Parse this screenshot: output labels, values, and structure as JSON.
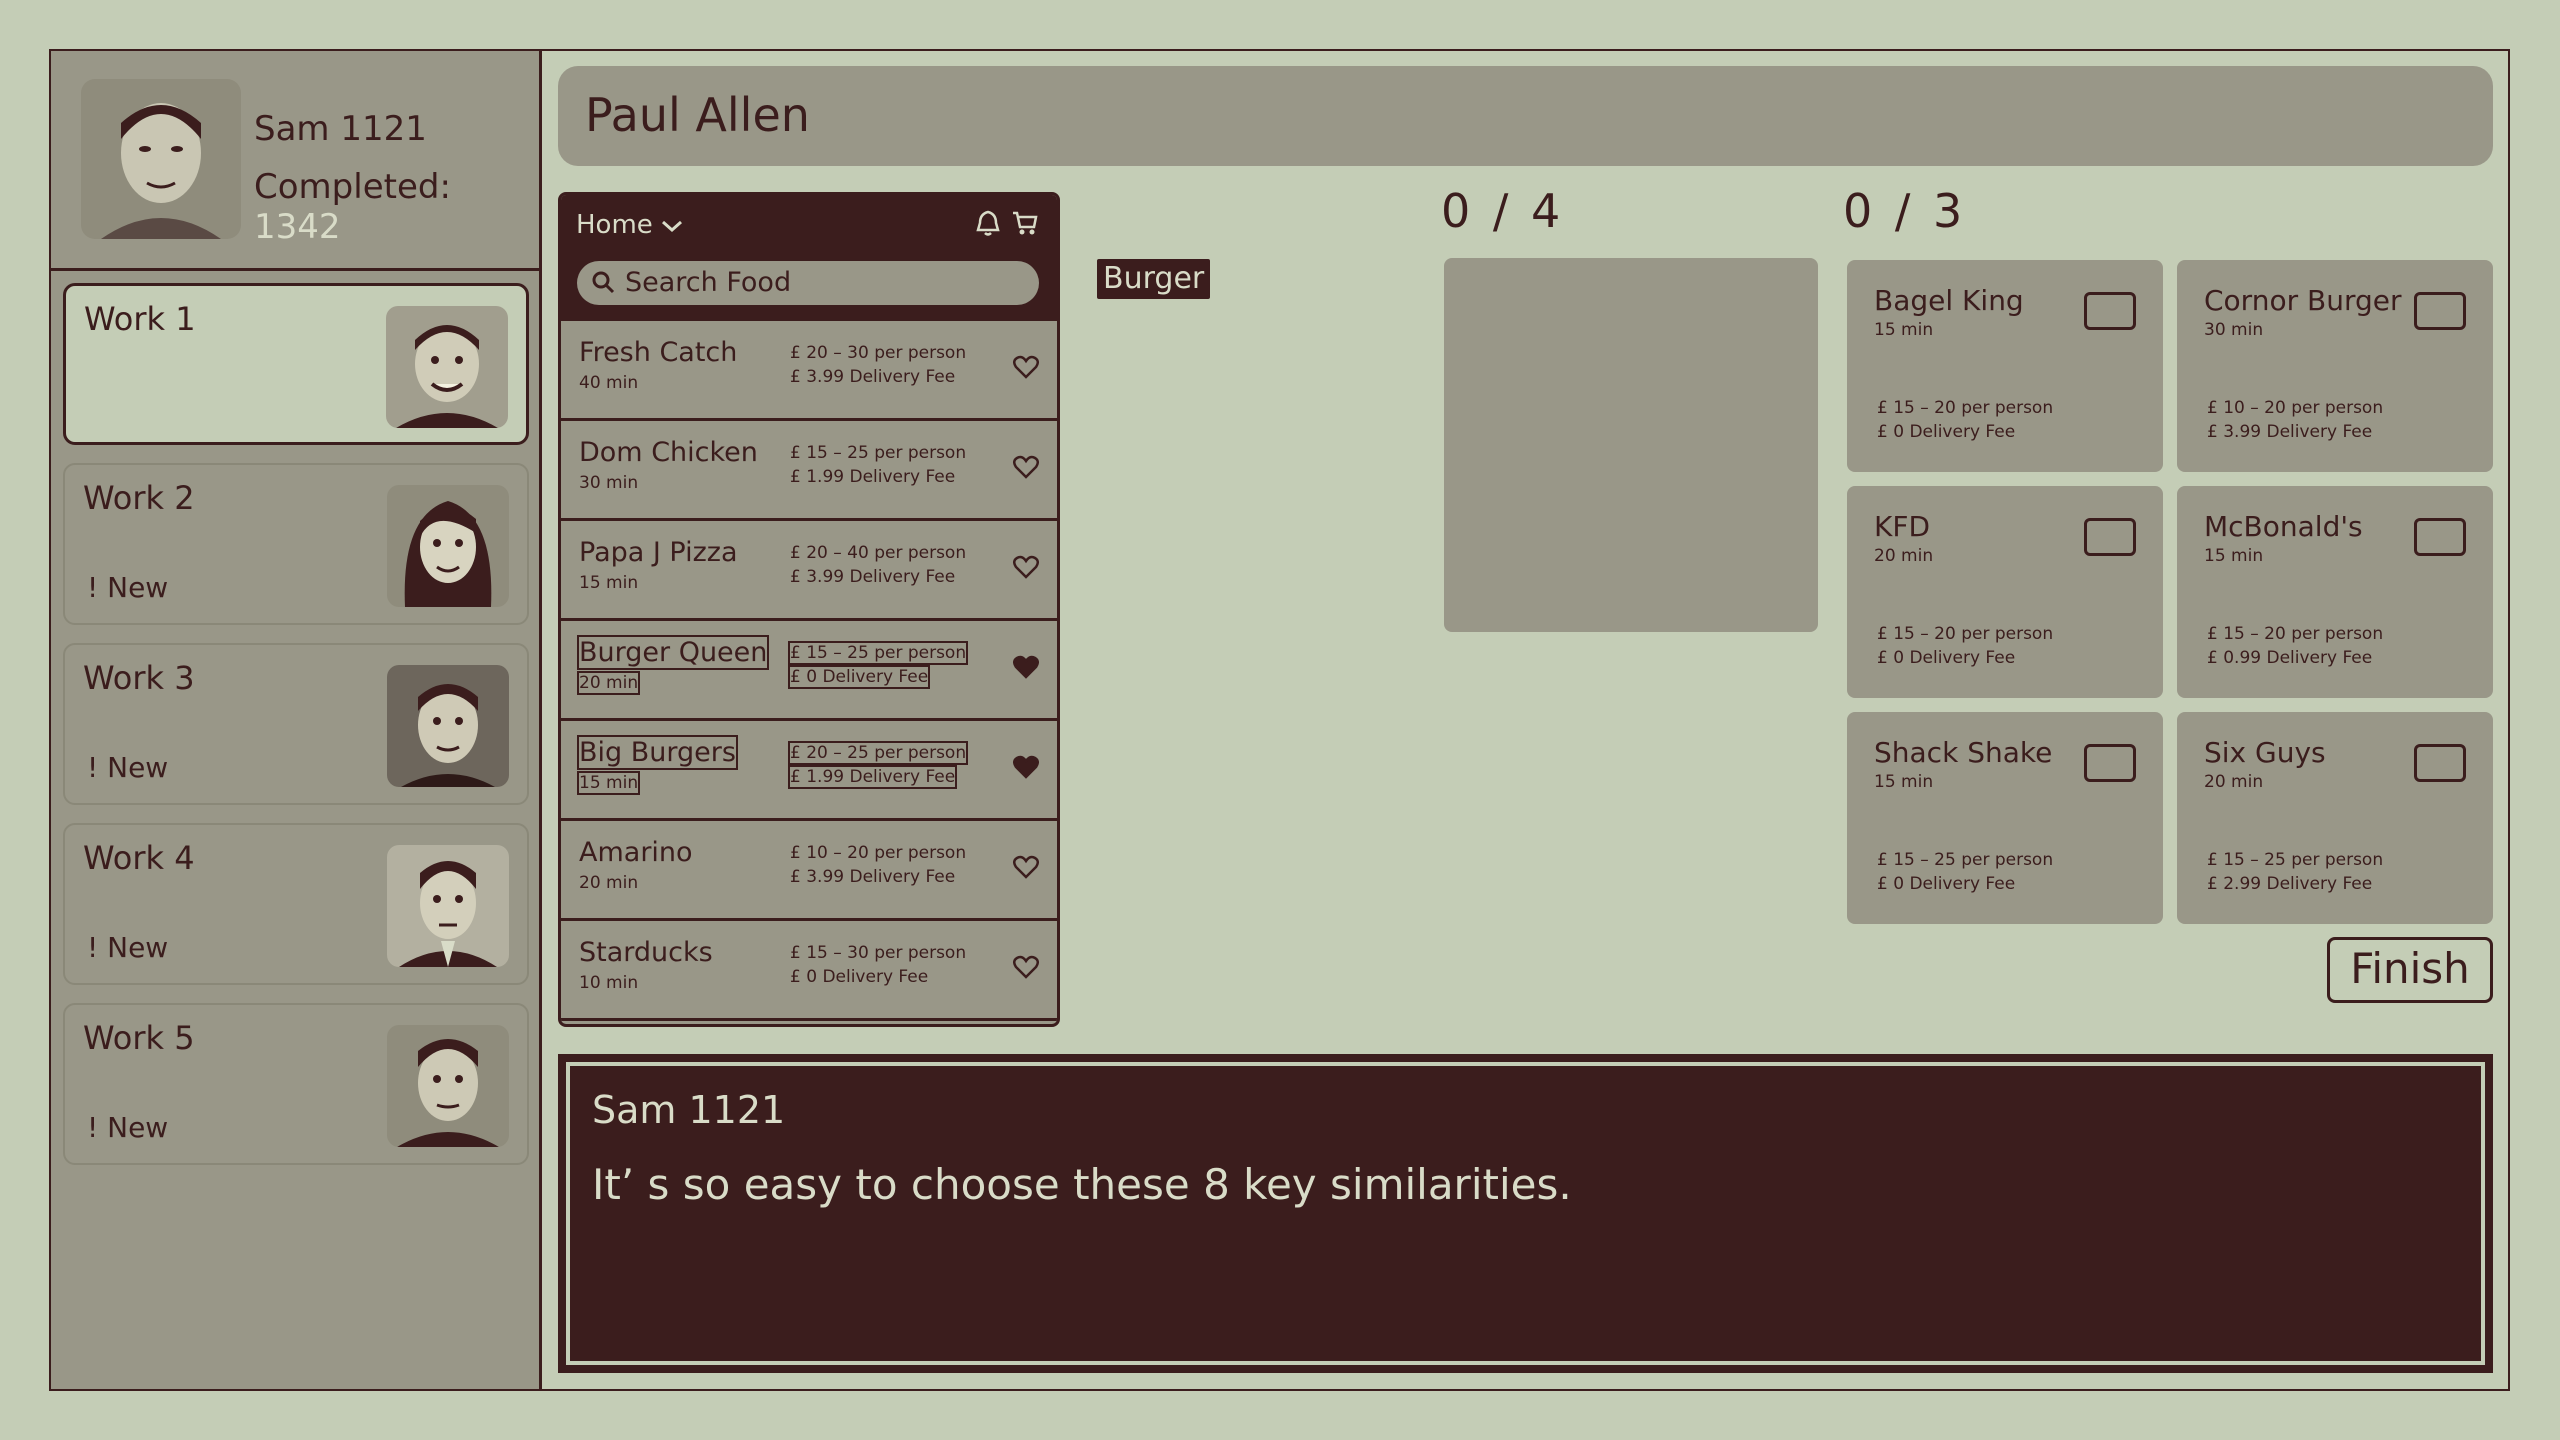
{
  "header": {
    "title": "Paul Allen"
  },
  "profile": {
    "name": "Sam 1121",
    "completed_label": "Completed:",
    "completed_value": "1342"
  },
  "works": [
    {
      "title": "Work 1",
      "badge": ""
    },
    {
      "title": "Work 2",
      "badge": "! New"
    },
    {
      "title": "Work 3",
      "badge": "! New"
    },
    {
      "title": "Work 4",
      "badge": "! New"
    },
    {
      "title": "Work 5",
      "badge": "! New"
    }
  ],
  "phone": {
    "home_label": "Home",
    "search_placeholder": "Search Food",
    "items": [
      {
        "name": "Fresh Catch",
        "time": "40 min",
        "price": "£ 20 – 30 per person",
        "fee": "£ 3.99 Delivery Fee",
        "favorite": false
      },
      {
        "name": "Dom Chicken",
        "time": "30 min",
        "price": "£ 15 – 25 per person",
        "fee": "£ 1.99 Delivery Fee",
        "favorite": false
      },
      {
        "name": "Papa J Pizza",
        "time": "15 min",
        "price": "£ 20 – 40 per person",
        "fee": "£ 3.99 Delivery Fee",
        "favorite": false
      },
      {
        "name": "Burger Queen",
        "time": "20 min",
        "price": "£ 15 – 25 per person",
        "fee": "£ 0 Delivery Fee",
        "favorite": true
      },
      {
        "name": "Big Burgers",
        "time": "15 min",
        "price": "£ 20 – 25 per person",
        "fee": "£ 1.99 Delivery Fee",
        "favorite": true
      },
      {
        "name": "Amarino",
        "time": "20 min",
        "price": "£ 10 – 20 per person",
        "fee": "£ 3.99 Delivery Fee",
        "favorite": false
      },
      {
        "name": "Starducks",
        "time": "10 min",
        "price": "£ 15 – 30 per person",
        "fee": "£ 0 Delivery Fee",
        "favorite": false
      }
    ]
  },
  "tag": "Burger",
  "counters": {
    "left": "0 / 4",
    "right": "0 / 3"
  },
  "restaurants": [
    {
      "name": "Bagel King",
      "time": "15 min",
      "price": "£ 15 – 20 per person",
      "fee": "£ 0 Delivery Fee"
    },
    {
      "name": "Cornor Burger",
      "time": "30 min",
      "price": "£ 10 – 20 per person",
      "fee": "£ 3.99 Delivery Fee"
    },
    {
      "name": "KFD",
      "time": "20 min",
      "price": "£ 15 – 20 per person",
      "fee": "£ 0 Delivery Fee"
    },
    {
      "name": "McBonald's",
      "time": "15 min",
      "price": "£ 15 – 20 per person",
      "fee": "£ 0.99 Delivery Fee"
    },
    {
      "name": "Shack Shake",
      "time": "15 min",
      "price": "£ 15 – 25 per person",
      "fee": "£ 0 Delivery Fee"
    },
    {
      "name": "Six Guys",
      "time": "20 min",
      "price": "£ 15 – 25 per person",
      "fee": "£ 2.99 Delivery Fee"
    }
  ],
  "finish_label": "Finish",
  "dialog": {
    "speaker": "Sam 1121",
    "text": "It’ s so easy to choose these 8 key similarities."
  }
}
